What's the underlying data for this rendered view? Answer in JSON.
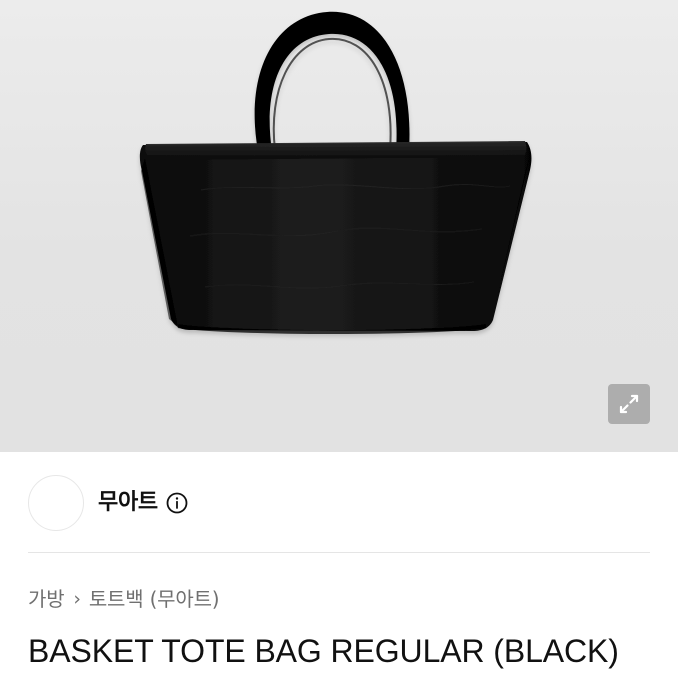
{
  "product": {
    "image_icon": "black-tote-bag-image",
    "expand_icon": "expand-icon",
    "title": "BASKET TOTE BAG REGULAR (BLACK)"
  },
  "seller": {
    "avatar_icon": "avatar",
    "name": "무아트",
    "info_icon": "info-icon"
  },
  "breadcrumb": {
    "items": [
      "가방",
      "토트백 (무아트)"
    ],
    "separator": "›"
  },
  "colors": {
    "background": "#ffffff",
    "image_background": "#e3e3e3",
    "text_primary": "#111111",
    "text_secondary": "#707070",
    "divider": "#e5e5e5",
    "bag": "#111111",
    "expand_button": "#878787"
  }
}
